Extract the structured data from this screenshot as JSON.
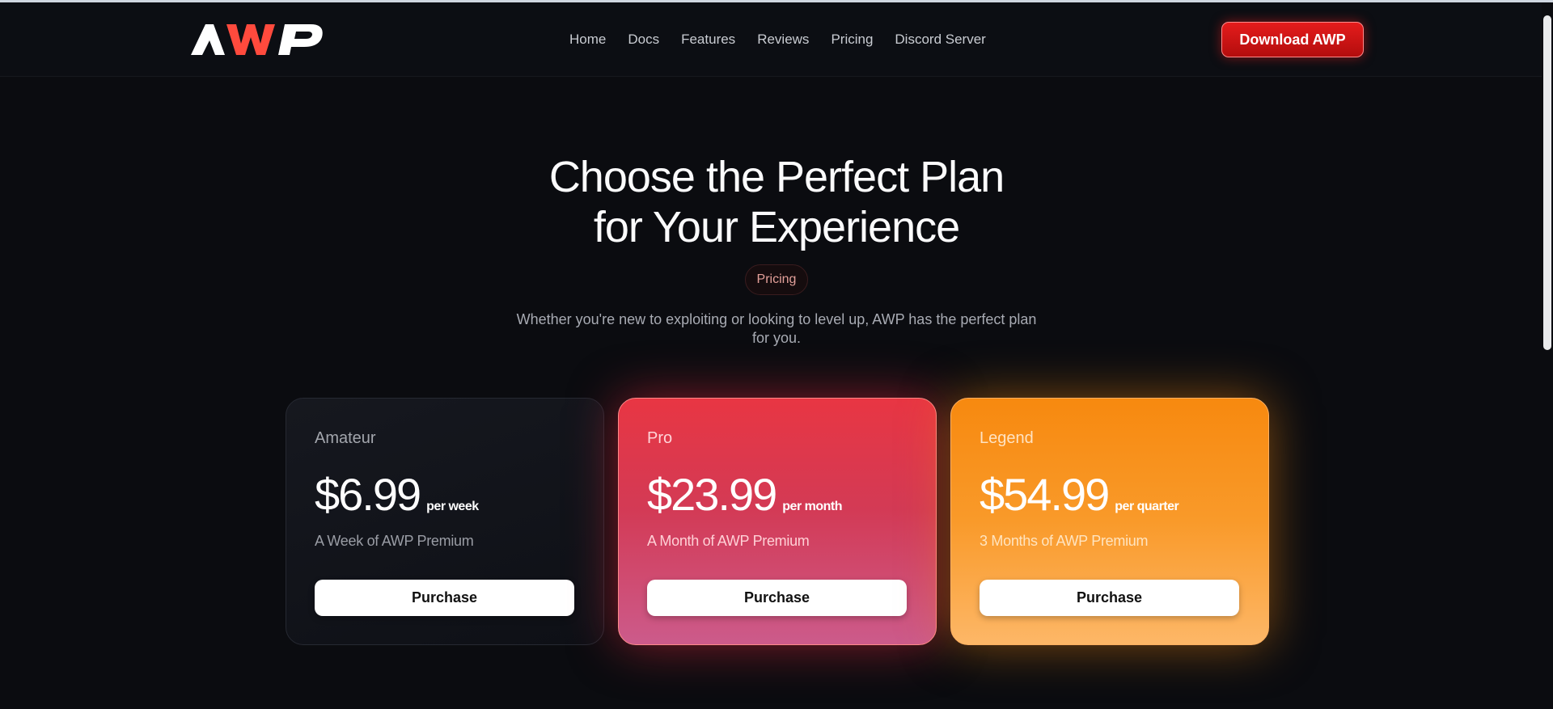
{
  "header": {
    "logo_text": "AWP",
    "nav": [
      "Home",
      "Docs",
      "Features",
      "Reviews",
      "Pricing",
      "Discord Server"
    ],
    "download_label": "Download AWP"
  },
  "hero": {
    "title_line1": "Choose the Perfect Plan",
    "title_line2": "for Your Experience",
    "badge": "Pricing",
    "subtitle_line1": "Whether you're new to exploiting or looking to level up, AWP has the perfect plan",
    "subtitle_line2": "for you."
  },
  "plans": [
    {
      "name": "Amateur",
      "price": "$6.99",
      "period": "per week",
      "description": "A Week of AWP Premium",
      "button": "Purchase"
    },
    {
      "name": "Pro",
      "price": "$23.99",
      "period": "per month",
      "description": "A Month of AWP Premium",
      "button": "Purchase"
    },
    {
      "name": "Legend",
      "price": "$54.99",
      "period": "per quarter",
      "description": "3 Months of AWP Premium",
      "button": "Purchase"
    }
  ],
  "colors": {
    "background": "#0b0c10",
    "accent_red": "#e51c1c",
    "logo_w": "#ff4a3d",
    "pro_card": "#e83643",
    "legend_card": "#f7890f"
  }
}
